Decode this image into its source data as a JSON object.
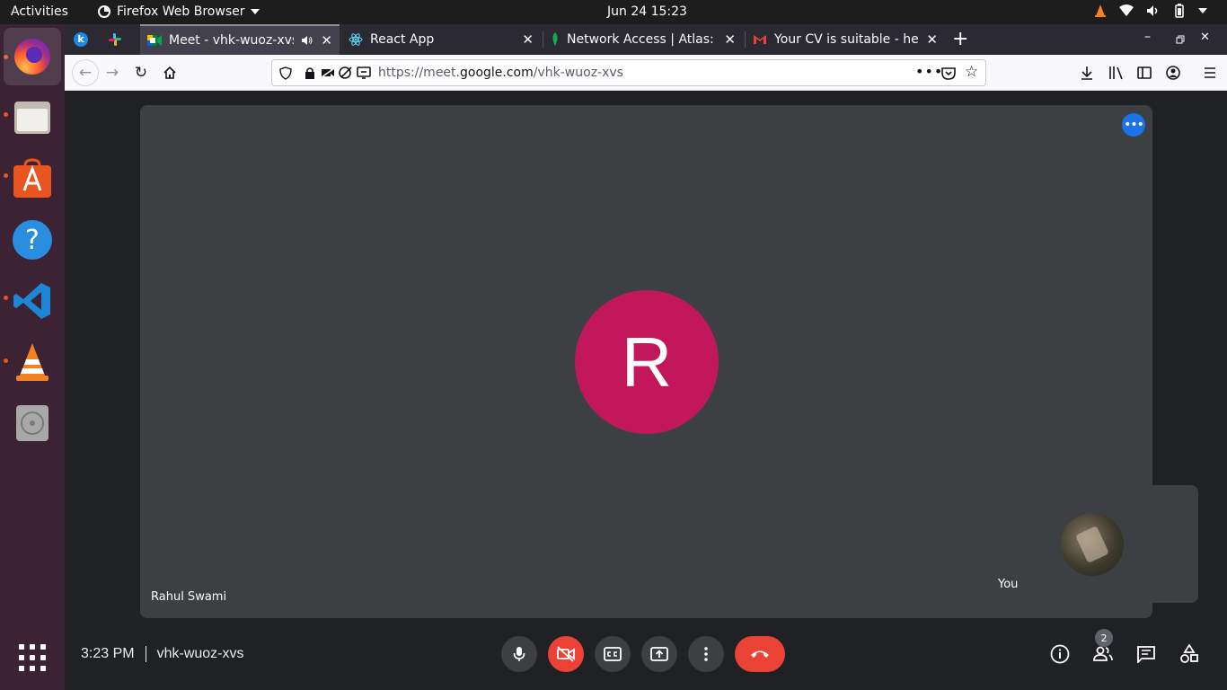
{
  "os": {
    "activities_label": "Activities",
    "app_menu_label": "Firefox Web Browser",
    "clock": "Jun 24  15:23"
  },
  "dock": {
    "items": [
      "firefox-icon",
      "files-icon",
      "software-icon",
      "help-icon",
      "vscode-icon",
      "vlc-icon",
      "disc-icon"
    ],
    "show_apps_icon": "apps-grid-icon"
  },
  "browser": {
    "tabs": [
      {
        "title": "",
        "icon": "k-app-icon",
        "pinned": true
      },
      {
        "title": "",
        "icon": "slack-icon",
        "pinned": true
      },
      {
        "title": "Meet - vhk-wuoz-xvs",
        "icon": "meet-icon",
        "selected": true,
        "audio": true
      },
      {
        "title": "React App",
        "icon": "react-icon"
      },
      {
        "title": "Network Access | Atlas: M",
        "icon": "mongodb-icon"
      },
      {
        "title": "Your CV is suitable - hem",
        "icon": "gmail-icon"
      }
    ],
    "url_prefix": "https://meet.",
    "url_domain": "google.com",
    "url_path": "/vhk-wuoz-xvs",
    "new_tab_label": "+"
  },
  "meet": {
    "main_participant_initial": "R",
    "main_participant_name": "Rahul Swami",
    "self_label": "You",
    "time": "3:23 PM",
    "meeting_code": "vhk-wuoz-xvs",
    "participants_count": "2",
    "colors": {
      "avatar": "#c2185b",
      "end_call": "#ea4335",
      "accent": "#1a73e8"
    }
  }
}
